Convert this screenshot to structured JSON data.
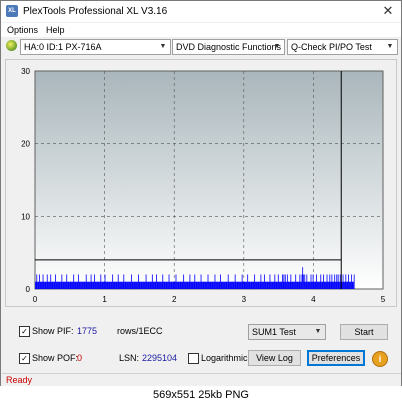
{
  "window": {
    "title": "PlexTools Professional XL V3.16",
    "icon_label": "XL",
    "close_glyph": "✕"
  },
  "menu": {
    "items": [
      "Options",
      "Help"
    ]
  },
  "toolbar": {
    "drive": "HA:0 ID:1  PX-716A",
    "function": "DVD Diagnostic Functions",
    "test": "Q-Check PI/PO Test",
    "arrow": "▼"
  },
  "chart_data": {
    "type": "bar",
    "xlim": [
      0,
      5
    ],
    "ylim": [
      0,
      30
    ],
    "x_ticks": [
      "0",
      "1",
      "2",
      "3",
      "4",
      "5"
    ],
    "y_ticks": [
      "0",
      "10",
      "20",
      "30"
    ],
    "grid": true,
    "plot_background": "gradient-gray",
    "threshold_y": 4,
    "end_marker_x": 4.4,
    "series": [
      {
        "color": "#0000ff",
        "x_start": 0,
        "x_step": 0.01,
        "values": [
          1,
          1,
          2,
          1,
          1,
          1,
          2,
          1,
          1,
          1,
          1,
          2,
          1,
          1,
          1,
          1,
          1,
          2,
          1,
          1,
          1,
          1,
          2,
          1,
          1,
          1,
          1,
          1,
          1,
          2,
          1,
          1,
          1,
          1,
          1,
          1,
          1,
          1,
          2,
          1,
          1,
          1,
          1,
          1,
          1,
          2,
          1,
          1,
          1,
          1,
          1,
          1,
          1,
          1,
          1,
          2,
          1,
          1,
          1,
          1,
          1,
          1,
          2,
          1,
          1,
          1,
          1,
          1,
          1,
          1,
          1,
          1,
          1,
          2,
          1,
          1,
          1,
          1,
          1,
          1,
          2,
          1,
          1,
          1,
          1,
          2,
          1,
          1,
          1,
          1,
          1,
          1,
          1,
          1,
          2,
          1,
          1,
          1,
          1,
          1,
          2,
          1,
          1,
          1,
          1,
          1,
          1,
          1,
          1,
          1,
          1,
          2,
          1,
          1,
          1,
          1,
          1,
          1,
          1,
          2,
          1,
          1,
          1,
          1,
          1,
          1,
          1,
          2,
          1,
          1,
          1,
          1,
          1,
          1,
          1,
          1,
          1,
          1,
          2,
          1,
          1,
          1,
          1,
          1,
          1,
          1,
          1,
          1,
          2,
          1,
          1,
          1,
          1,
          1,
          1,
          1,
          1,
          1,
          1,
          2,
          1,
          1,
          1,
          1,
          1,
          1,
          1,
          1,
          2,
          1,
          1,
          1,
          1,
          1,
          2,
          1,
          1,
          1,
          1,
          1,
          1,
          1,
          1,
          2,
          1,
          1,
          1,
          1,
          1,
          1,
          1,
          1,
          2,
          1,
          1,
          1,
          1,
          1,
          1,
          1,
          1,
          1,
          2,
          1,
          1,
          1,
          1,
          1,
          1,
          1,
          1,
          1,
          1,
          2,
          1,
          1,
          1,
          1,
          1,
          1,
          1,
          1,
          2,
          1,
          1,
          1,
          1,
          1,
          1,
          2,
          1,
          1,
          1,
          1,
          1,
          1,
          1,
          1,
          2,
          1,
          1,
          1,
          1,
          1,
          1,
          1,
          1,
          1,
          2,
          1,
          1,
          1,
          1,
          1,
          1,
          1,
          1,
          1,
          2,
          1,
          1,
          1,
          1,
          1,
          1,
          1,
          2,
          1,
          1,
          1,
          1,
          1,
          1,
          1,
          1,
          1,
          1,
          2,
          1,
          1,
          1,
          1,
          1,
          1,
          1,
          1,
          1,
          2,
          1,
          1,
          1,
          1,
          1,
          1,
          1,
          1,
          1,
          2,
          1,
          1,
          1,
          1,
          1,
          1,
          1,
          2,
          1,
          1,
          1,
          1,
          1,
          1,
          1,
          1,
          1,
          2,
          1,
          1,
          1,
          1,
          1,
          1,
          1,
          1,
          2,
          1,
          1,
          1,
          1,
          2,
          1,
          1,
          1,
          1,
          1,
          1,
          1,
          2,
          1,
          1,
          1,
          1,
          1,
          1,
          2,
          1,
          1,
          1,
          1,
          2,
          1,
          1,
          1,
          1,
          1,
          2,
          1,
          2,
          1,
          2,
          1,
          1,
          2,
          1,
          1,
          1,
          1,
          2,
          1,
          1,
          1,
          1,
          1,
          1,
          2,
          1,
          1,
          1,
          1,
          1,
          2,
          1,
          1,
          2,
          3,
          2,
          1,
          2,
          1,
          1,
          2,
          1,
          1,
          1,
          1,
          1,
          2,
          1,
          1,
          2,
          1,
          1,
          1,
          1,
          2,
          1,
          1,
          1,
          1,
          1,
          2,
          1,
          1,
          1,
          2,
          1,
          1,
          1,
          1,
          2,
          1,
          1,
          1,
          2,
          1,
          1,
          2,
          1,
          1,
          1,
          2,
          1,
          1,
          2,
          1,
          2,
          1,
          1,
          2,
          1,
          1,
          1,
          2,
          1,
          1,
          1,
          2,
          1,
          1,
          1,
          2,
          1,
          1,
          1,
          2,
          1,
          1,
          1,
          2
        ]
      }
    ]
  },
  "controls": {
    "show_pif": {
      "label": "Show PIF:",
      "value": "1775",
      "units": "rows/1ECC",
      "checked": "✓"
    },
    "show_pof": {
      "label": "Show POF:",
      "value": "0",
      "checked": "✓"
    },
    "lsn": {
      "label": "LSN:",
      "value": "2295104"
    },
    "logarithmic": {
      "label": "Logarithmic",
      "checked": ""
    },
    "sum_test": "SUM1 Test",
    "start_label": "Start",
    "view_log_label": "View Log",
    "preferences_label": "Preferences",
    "info_glyph": "i"
  },
  "status": {
    "text": "Ready",
    "color": "#cc0000"
  },
  "caption": "569x551  25kb  PNG"
}
